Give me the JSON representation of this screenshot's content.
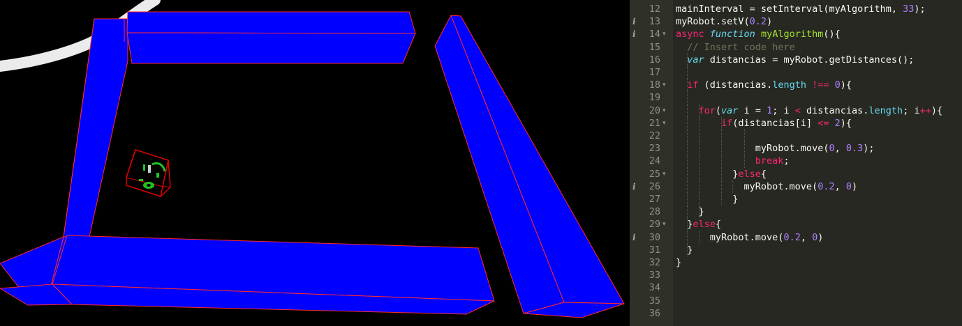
{
  "scene": {
    "walls_color": "#0000ff",
    "edges_color": "#ff2a2a",
    "robot": {
      "body": "#000000",
      "frame": "#e00000",
      "wheels": "#22c422"
    }
  },
  "editor": {
    "background": "#272822",
    "gutter_background": "#2f3129",
    "lines": [
      {
        "n": "12",
        "fold": false,
        "info": false,
        "tokens": [
          {
            "t": "mainInterval = setInterval(myAlgorithm, ",
            "c": "pl"
          },
          {
            "t": "33",
            "c": "nm"
          },
          {
            "t": ");",
            "c": "pl"
          }
        ]
      },
      {
        "n": "13",
        "fold": false,
        "info": true,
        "tokens": [
          {
            "t": "myRobot.setV(",
            "c": "pl"
          },
          {
            "t": "0.2",
            "c": "nm"
          },
          {
            "t": ")",
            "c": "pl"
          }
        ]
      },
      {
        "n": "14",
        "fold": true,
        "info": true,
        "tokens": [
          {
            "t": "async",
            "c": "kw"
          },
          {
            "t": " ",
            "c": "pl"
          },
          {
            "t": "function",
            "c": "st"
          },
          {
            "t": " ",
            "c": "pl"
          },
          {
            "t": "myAlgorithm",
            "c": "fn"
          },
          {
            "t": "(){",
            "c": "pl"
          }
        ]
      },
      {
        "n": "15",
        "fold": false,
        "info": false,
        "tokens": [
          {
            "t": "  ",
            "c": "pl"
          },
          {
            "t": "// Insert code here",
            "c": "cm"
          }
        ]
      },
      {
        "n": "16",
        "fold": false,
        "info": false,
        "tokens": [
          {
            "t": "  ",
            "c": "pl"
          },
          {
            "t": "var",
            "c": "st"
          },
          {
            "t": " distancias = myRobot.getDistances();",
            "c": "pl"
          }
        ]
      },
      {
        "n": "17",
        "fold": false,
        "info": false,
        "tokens": []
      },
      {
        "n": "18",
        "fold": true,
        "info": false,
        "tokens": [
          {
            "t": "  ",
            "c": "pl"
          },
          {
            "t": "if",
            "c": "kw"
          },
          {
            "t": " (distancias.",
            "c": "pl"
          },
          {
            "t": "length",
            "c": "pr"
          },
          {
            "t": " ",
            "c": "pl"
          },
          {
            "t": "!==",
            "c": "kw"
          },
          {
            "t": " ",
            "c": "pl"
          },
          {
            "t": "0",
            "c": "nm"
          },
          {
            "t": "){",
            "c": "pl"
          }
        ]
      },
      {
        "n": "19",
        "fold": false,
        "info": false,
        "tokens": []
      },
      {
        "n": "20",
        "fold": true,
        "info": false,
        "tokens": [
          {
            "t": "    ",
            "c": "pl"
          },
          {
            "t": "for",
            "c": "kw"
          },
          {
            "t": "(",
            "c": "pl"
          },
          {
            "t": "var",
            "c": "st"
          },
          {
            "t": " i = ",
            "c": "pl"
          },
          {
            "t": "1",
            "c": "nm"
          },
          {
            "t": "; i ",
            "c": "pl"
          },
          {
            "t": "<",
            "c": "kw"
          },
          {
            "t": " distancias.",
            "c": "pl"
          },
          {
            "t": "length",
            "c": "pr"
          },
          {
            "t": "; i",
            "c": "pl"
          },
          {
            "t": "++",
            "c": "kw"
          },
          {
            "t": "){",
            "c": "pl"
          }
        ]
      },
      {
        "n": "21",
        "fold": true,
        "info": false,
        "tokens": [
          {
            "t": "        ",
            "c": "pl"
          },
          {
            "t": "if",
            "c": "kw"
          },
          {
            "t": "(distancias[i] ",
            "c": "pl"
          },
          {
            "t": "<=",
            "c": "kw"
          },
          {
            "t": " ",
            "c": "pl"
          },
          {
            "t": "2",
            "c": "nm"
          },
          {
            "t": "){",
            "c": "pl"
          }
        ]
      },
      {
        "n": "22",
        "fold": false,
        "info": false,
        "tokens": []
      },
      {
        "n": "23",
        "fold": false,
        "info": false,
        "tokens": [
          {
            "t": "              myRobot.move(",
            "c": "pl"
          },
          {
            "t": "0",
            "c": "nm"
          },
          {
            "t": ", ",
            "c": "pl"
          },
          {
            "t": "0.3",
            "c": "nm"
          },
          {
            "t": ");",
            "c": "pl"
          }
        ]
      },
      {
        "n": "24",
        "fold": false,
        "info": false,
        "tokens": [
          {
            "t": "              ",
            "c": "pl"
          },
          {
            "t": "break",
            "c": "kw"
          },
          {
            "t": ";",
            "c": "pl"
          }
        ]
      },
      {
        "n": "25",
        "fold": true,
        "info": false,
        "tokens": [
          {
            "t": "          }",
            "c": "pl"
          },
          {
            "t": "else",
            "c": "kw"
          },
          {
            "t": "{",
            "c": "pl"
          }
        ]
      },
      {
        "n": "26",
        "fold": false,
        "info": true,
        "tokens": [
          {
            "t": "            myRobot.move(",
            "c": "pl"
          },
          {
            "t": "0.2",
            "c": "nm"
          },
          {
            "t": ", ",
            "c": "pl"
          },
          {
            "t": "0",
            "c": "nm"
          },
          {
            "t": ")",
            "c": "pl"
          }
        ]
      },
      {
        "n": "27",
        "fold": false,
        "info": false,
        "tokens": [
          {
            "t": "          }",
            "c": "pl"
          }
        ]
      },
      {
        "n": "28",
        "fold": false,
        "info": false,
        "tokens": [
          {
            "t": "    }",
            "c": "pl"
          }
        ]
      },
      {
        "n": "29",
        "fold": true,
        "info": false,
        "tokens": [
          {
            "t": "  }",
            "c": "pl"
          },
          {
            "t": "else",
            "c": "kw"
          },
          {
            "t": "{",
            "c": "pl"
          }
        ]
      },
      {
        "n": "30",
        "fold": false,
        "info": true,
        "tokens": [
          {
            "t": "      myRobot.move(",
            "c": "pl"
          },
          {
            "t": "0.2",
            "c": "nm"
          },
          {
            "t": ", ",
            "c": "pl"
          },
          {
            "t": "0",
            "c": "nm"
          },
          {
            "t": ")",
            "c": "pl"
          }
        ]
      },
      {
        "n": "31",
        "fold": false,
        "info": false,
        "tokens": [
          {
            "t": "  }",
            "c": "pl"
          }
        ]
      },
      {
        "n": "32",
        "fold": false,
        "info": false,
        "tokens": [
          {
            "t": "}",
            "c": "pl"
          }
        ]
      },
      {
        "n": "33",
        "fold": false,
        "info": false,
        "tokens": []
      },
      {
        "n": "34",
        "fold": false,
        "info": false,
        "tokens": []
      },
      {
        "n": "35",
        "fold": false,
        "info": false,
        "tokens": []
      },
      {
        "n": "36",
        "fold": false,
        "info": false,
        "tokens": []
      }
    ]
  }
}
